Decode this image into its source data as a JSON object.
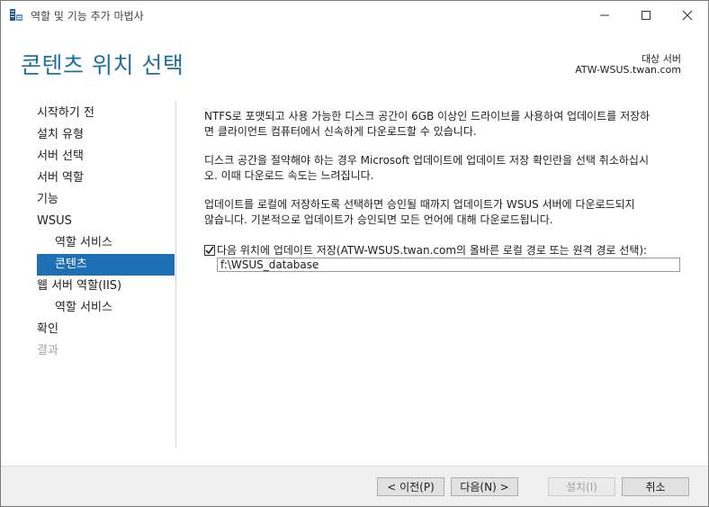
{
  "window": {
    "title": "역할 및 기능 추가 마법사"
  },
  "header": {
    "page_title": "콘텐츠 위치 선택",
    "dest_label": "대상 서버",
    "dest_server": "ATW-WSUS.twan.com"
  },
  "nav": {
    "items": [
      {
        "label": "시작하기 전"
      },
      {
        "label": "설치 유형"
      },
      {
        "label": "서버 선택"
      },
      {
        "label": "서버 역할"
      },
      {
        "label": "기능"
      },
      {
        "label": "WSUS"
      },
      {
        "label": "역할 서비스"
      },
      {
        "label": "콘텐츠"
      },
      {
        "label": "웹 서버 역할(IIS)"
      },
      {
        "label": "역할 서비스"
      },
      {
        "label": "확인"
      },
      {
        "label": "결과"
      }
    ]
  },
  "content": {
    "para1_line1": "NTFS로 포맷되고 사용 가능한 디스크 공간이 6GB 이상인 드라이브를 사용하여 업데이트를 저장하",
    "para1_line2": "면 클라이언트 컴퓨터에서 신속하게 다운로드할 수 있습니다.",
    "para2_line1": "디스크 공간을 절약해야 하는 경우 Microsoft 업데이트에 업데이트 저장 확인란을 선택 취소하십시",
    "para2_line2": "오. 이때 다운로드 속도는 느려집니다.",
    "para3_line1": "업데이트를 로컬에 저장하도록 선택하면 승인될 때까지 업데이트가 WSUS 서버에 다운로드되지",
    "para3_line2": "않습니다. 기본적으로 업데이트가 승인되면 모든 언어에 대해 다운로드됩니다.",
    "store_checkbox_label": "다음 위치에 업데이트 저장(ATW-WSUS.twan.com의 올바른 로컬 경로 또는 원격 경로 선택):",
    "store_checked": true,
    "path_value": "f:\\WSUS_database"
  },
  "footer": {
    "prev_label": "< 이전(P)",
    "next_label": "다음(N) >",
    "install_label": "설치(I)",
    "cancel_label": "취소"
  },
  "colors": {
    "accent": "#1f6fb4",
    "title_blue": "#1f6f9e"
  }
}
